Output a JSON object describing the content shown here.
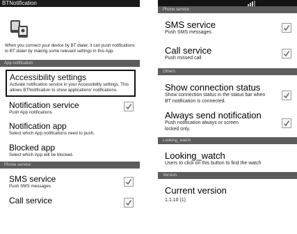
{
  "left": {
    "app_title": "BTNotification",
    "intro_text": "When you connect your device by BT dialer, it can push notifications to BT dialer by making some relevant settings in this App.",
    "section_app_notification": "App notification",
    "accessibility": {
      "title": "Accessibility settings",
      "summary": "Activate notification service in your Accessibility settings. This allows BTNotification to show applications' notifications."
    },
    "notification_service": {
      "title": "Notification service",
      "summary": "Push App notifications",
      "checked": true
    },
    "notification_app": {
      "title": "Notification app",
      "summary": "Select which App notifications need to push."
    },
    "blocked_app": {
      "title": "Blocked app",
      "summary": "Select which App will be blocked."
    },
    "section_phone_service": "Phone service",
    "sms_service": {
      "title": "SMS service",
      "summary": "Push SMS messages",
      "checked": true
    },
    "call_service": {
      "title": "Call service",
      "checked": true
    }
  },
  "right": {
    "section_phone_service": "Phone service",
    "sms_service": {
      "title": "SMS service",
      "summary": "Push SMS messages",
      "checked": true
    },
    "call_service": {
      "title": "Call service",
      "summary": "Push missed call",
      "checked": true
    },
    "section_others": "Others",
    "show_connection": {
      "title": "Show connection status",
      "summary": "Show connection status in the status bar when BT notification is connected.",
      "checked": true
    },
    "always_send": {
      "title": "Always send notification",
      "summary": "Push notification always or screen locked only.",
      "checked": true
    },
    "section_looking": "Looking_watch",
    "looking_watch": {
      "title": "Looking_watch",
      "summary": "Users to click on this button to find the watch"
    },
    "section_version": "Version",
    "current_version": {
      "title": "Current version",
      "value": "1.1.10 (1)"
    }
  },
  "colors": {
    "section_header": "#5c5c5c",
    "status_bar": "#141414",
    "checkmark": "#5f5f5f"
  },
  "icons": [
    "bt-notification-logo-icon",
    "signal-icon",
    "checkmark-icon"
  ]
}
